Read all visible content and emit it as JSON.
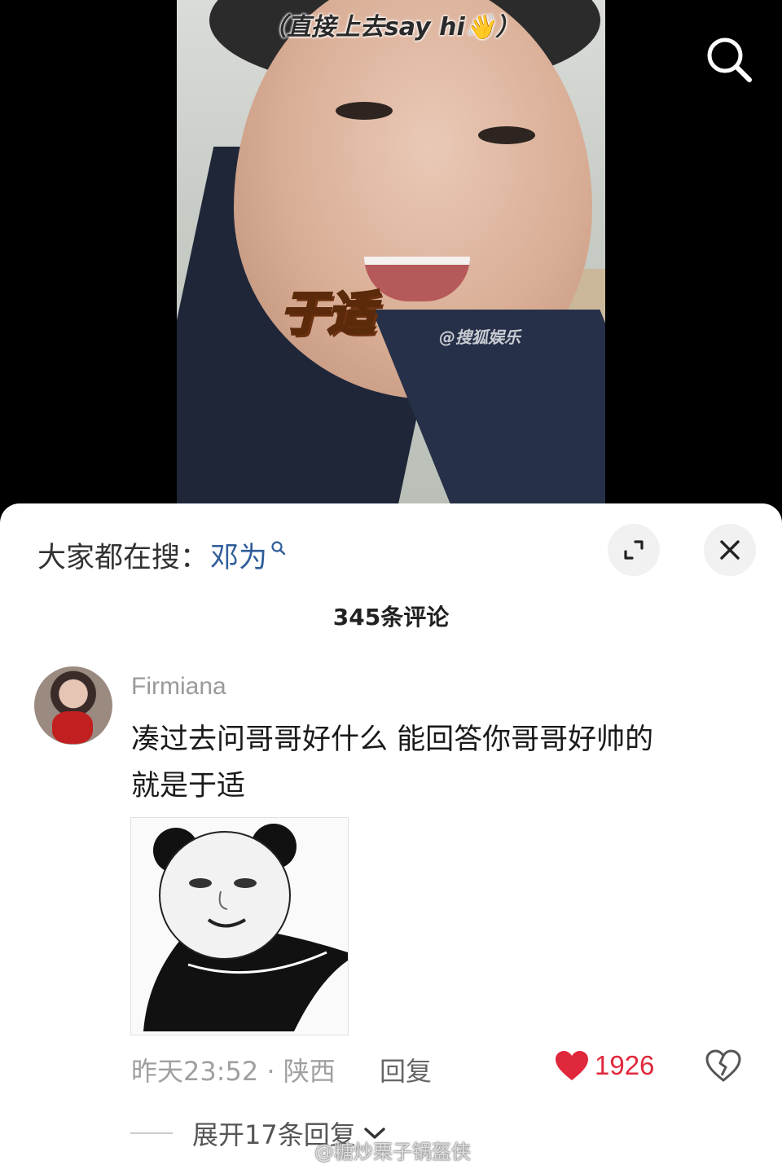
{
  "video": {
    "caption": "（直接上去say hi👋）",
    "name_sticker": "于适",
    "watermark": "@搜狐娱乐"
  },
  "sheet": {
    "hot_search_label": "大家都在搜：",
    "hot_search_term": "邓为",
    "comment_count": "345条评论"
  },
  "comment": {
    "username": "Firmiana",
    "text_line1": "凑过去问哥哥好什么 能回答你哥哥好帅的",
    "text_line2": "就是于适",
    "meta": "昨天23:52 · 陕西",
    "reply_label": "回复",
    "like_count": "1926",
    "expand_label": "展开17条回复"
  },
  "overlay_watermark": "@糖炒栗子锅盔侠",
  "colors": {
    "like": "#e0283c",
    "link": "#2f5d9a"
  }
}
